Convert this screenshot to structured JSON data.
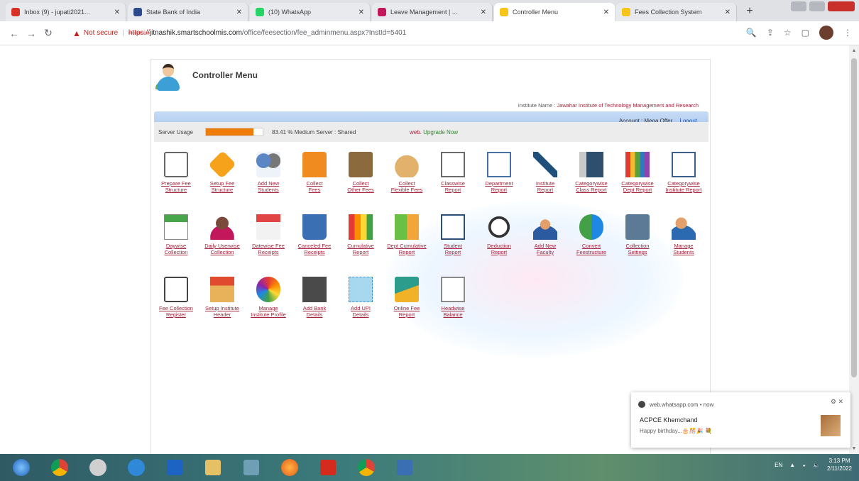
{
  "browser": {
    "tabs": [
      {
        "label": "Inbox (9) - jupati2021... ",
        "color": "#d93025"
      },
      {
        "label": "State Bank of India",
        "color": "#2c4a8c"
      },
      {
        "label": "(10) WhatsApp",
        "color": "#25d366"
      },
      {
        "label": "Leave Management | ...",
        "color": "#c2185b"
      },
      {
        "label": "Controller Menu",
        "color": "#f5c518"
      },
      {
        "label": "Fees Collection System",
        "color": "#f5c518"
      }
    ],
    "new_tab": "+",
    "address": {
      "security": "Not secure",
      "scheme": "https://",
      "host": "jitnashik.smartschoolmis.com",
      "path": "/office/feesection/fee_adminmenu.aspx?InstId=5401"
    }
  },
  "page": {
    "title": "Controller Menu",
    "institute_label": "Institute Name :",
    "institute_name": "Jawahar Institute of Technology Management and Research",
    "account_label": "Account : Mega Offer",
    "logout": "Logout",
    "server": {
      "label": "Server Usage",
      "usage_percent": 83.41,
      "text": "83.41 % Medium Server : Shared",
      "upgrade_prefix": "web.",
      "upgrade_link": "Upgrade Now"
    },
    "menu": [
      [
        "Prepare Fee",
        "Structure"
      ],
      [
        "Setup Fee",
        "Structure"
      ],
      [
        "Add New",
        "Students"
      ],
      [
        "Collect",
        "Fees"
      ],
      [
        "Collect",
        "Other Fees"
      ],
      [
        "Collect",
        "Flexible Fees"
      ],
      [
        "Classwise",
        "Report"
      ],
      [
        "Department",
        "Report"
      ],
      [
        "Institute",
        "Report"
      ],
      [
        "Categorywise",
        "Class Report"
      ],
      [
        "Categorywise",
        "Dept Report"
      ],
      [
        "Categorywise",
        "Institute Report"
      ],
      [
        "Daywise",
        "Collection"
      ],
      [
        "Daily Userwise",
        "Collection"
      ],
      [
        "Datewise Fee",
        "Receipts"
      ],
      [
        "Canceled Fee",
        "Receipts"
      ],
      [
        "Cumulative",
        "Report"
      ],
      [
        "Dept Cumulative",
        "Report"
      ],
      [
        "Student",
        "Report"
      ],
      [
        "Deduction",
        "Report"
      ],
      [
        "Add New",
        "Faculty"
      ],
      [
        "Convert",
        "Feestructure"
      ],
      [
        "Collection",
        "Settings"
      ],
      [
        "Manage",
        "Students"
      ],
      [
        "Fee Collection",
        "Register"
      ],
      [
        "Setup Institute",
        "Header"
      ],
      [
        "Manage",
        "Institute Profile"
      ],
      [
        "Add Bank",
        "Details"
      ],
      [
        "Add UPI",
        "Details"
      ],
      [
        "Online Fee",
        "Report"
      ],
      [
        "Headwise",
        "Balance"
      ]
    ]
  },
  "toast": {
    "source": "web.whatsapp.com • now",
    "sender": "ACPCE Khemchand",
    "message": "Happy birthday...🎂🎊🎉 💐"
  },
  "taskbar": {
    "lang": "EN",
    "time": "3:13 PM",
    "date": "2/11/2022"
  }
}
